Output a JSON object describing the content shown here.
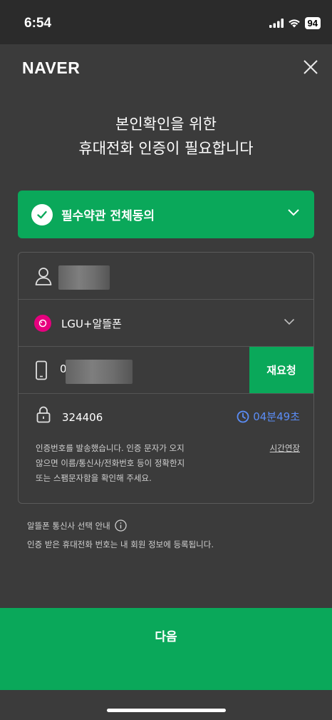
{
  "status": {
    "time": "6:54",
    "battery": "94"
  },
  "header": {
    "logo": "NAVER"
  },
  "headline": {
    "line1": "본인확인을 위한",
    "line2": "휴대전화 인증이 필요합니다"
  },
  "agreement": {
    "label": "필수약관 전체동의"
  },
  "form": {
    "carrier": "LGU+알뜰폰",
    "phone_prefix": "0",
    "resend_label": "재요청",
    "code_value": "324406",
    "timer": "04분49초",
    "notice_line1": "인증번호를 발송했습니다. 인증 문자가 오지",
    "notice_line2": "않으면 이름/통신사/전화번호 등이 정확한지",
    "notice_line3": "또는 스팸문자함을 확인해 주세요.",
    "extend_label": "시간연장"
  },
  "footer_info": {
    "mvno_guide": "알뜰폰 통신사 선택 안내",
    "note": "인증 받은 휴대전화 번호는 내 회원 정보에 등록됩니다."
  },
  "next_button": {
    "label": "다음"
  },
  "colors": {
    "accent": "#0aa85a",
    "timer": "#5b8df6",
    "background": "#3b3b3b"
  }
}
